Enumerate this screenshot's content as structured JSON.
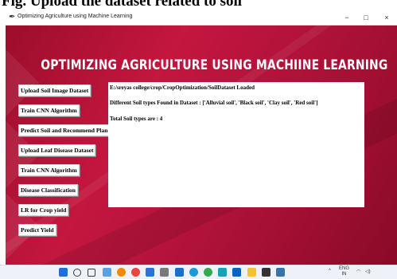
{
  "caption": "Fig. Upload the dataset related to soil",
  "window": {
    "title": "Optimizing Agriculture using Machine Learning",
    "minimize": "−",
    "maximize": "□",
    "close": "×"
  },
  "heading": "OPTIMIZING AGRICULTURE USING MACHIINE LEARNING",
  "buttons": [
    {
      "label": "Upload Soil Image Dataset"
    },
    {
      "label": "Train CNN Algorithm"
    },
    {
      "label": "Predict Soil and Recommend Plant"
    },
    {
      "label": "Upload Leaf Disease Dataset"
    },
    {
      "label": "Train CNN Algorithm"
    },
    {
      "label": "Disease Classification"
    },
    {
      "label": "LR for Crop yield"
    },
    {
      "label": "Predict Yield"
    }
  ],
  "output": {
    "lines": [
      "E:/sreyas college/crop/CropOptimization/SoilDataset Loaded",
      "Different Soil types Found in Dataset : ['Alluvial soil', 'Black soil', 'Clay soil', 'Red soil']",
      "Total Soil types are : 4"
    ]
  },
  "taskbar": {
    "icons": [
      {
        "name": "windows-start-icon",
        "color": "#1f6fd6"
      },
      {
        "name": "search-icon",
        "color": "#3a3a3a"
      },
      {
        "name": "task-view-icon",
        "color": "#3a3a3a"
      },
      {
        "name": "widgets-icon",
        "color": "#5aa0e6"
      },
      {
        "name": "vlc-icon",
        "color": "#f08a00"
      },
      {
        "name": "chrome-icon",
        "color": "#e8453c"
      },
      {
        "name": "app-icon",
        "color": "#2b73d8"
      },
      {
        "name": "settings-icon",
        "color": "#7a7a7a"
      },
      {
        "name": "mail-icon",
        "color": "#1b6fc8"
      },
      {
        "name": "edge-icon",
        "color": "#1a9bd7"
      },
      {
        "name": "chrome-icon",
        "color": "#34a853"
      },
      {
        "name": "photos-icon",
        "color": "#17a2b8"
      },
      {
        "name": "store-icon",
        "color": "#0a64c4"
      },
      {
        "name": "file-explorer-icon",
        "color": "#f2c230"
      },
      {
        "name": "terminal-icon",
        "color": "#333333"
      },
      {
        "name": "python-icon",
        "color": "#3775a9"
      }
    ],
    "tray_chevron": "^",
    "language_top": "ENG",
    "language_bottom": "IN"
  }
}
